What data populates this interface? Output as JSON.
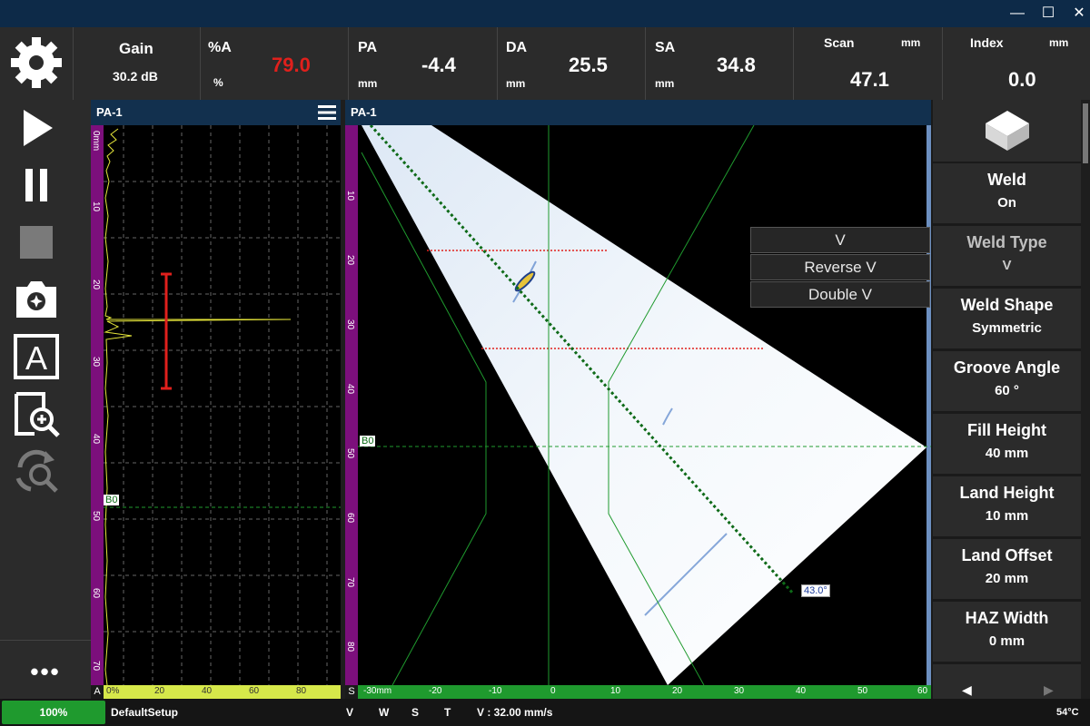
{
  "window": {
    "minimize": "—",
    "maximize": "☐",
    "close": "✕"
  },
  "sidebar": {
    "items": [
      {
        "name": "settings-gear-icon"
      },
      {
        "name": "play-icon"
      },
      {
        "name": "pause-icon"
      },
      {
        "name": "stop-icon"
      },
      {
        "name": "snapshot-icon"
      },
      {
        "name": "text-annotation-icon"
      },
      {
        "name": "zoom-icon"
      },
      {
        "name": "rotate-zoom-icon"
      }
    ],
    "more": "•••"
  },
  "readouts": {
    "gain": {
      "label": "Gain",
      "value": "30.2 dB"
    },
    "pctA": {
      "label": "%A",
      "unit": "%",
      "value": "79.0",
      "color": "#e0201c"
    },
    "pa": {
      "label": "PA",
      "unit": "mm",
      "value": "-4.4"
    },
    "da": {
      "label": "DA",
      "unit": "mm",
      "value": "25.5"
    },
    "sa": {
      "label": "SA",
      "unit": "mm",
      "value": "34.8"
    },
    "scan": {
      "label": "Scan",
      "unit": "mm",
      "value": "47.1"
    },
    "index": {
      "label": "Index",
      "unit": "mm",
      "value": "0.0"
    }
  },
  "ascan": {
    "title": "PA-1",
    "menu_icon": "hamburger-menu-icon",
    "depth_ticks": [
      "0mm",
      "10",
      "20",
      "30",
      "30",
      "40",
      "50",
      "60",
      "70"
    ],
    "amp_ticks": [
      "0%",
      "20",
      "40",
      "60",
      "80"
    ],
    "corner": "A",
    "gate_label": "B0"
  },
  "sscan": {
    "title": "PA-1",
    "depth_ticks": [
      "10",
      "20",
      "30",
      "40",
      "50",
      "60",
      "70",
      "80"
    ],
    "x_ticks": [
      "-30mm",
      "-20",
      "-10",
      "0",
      "10",
      "20",
      "30",
      "40",
      "50",
      "60"
    ],
    "corner": "S",
    "gate_label": "B0",
    "angle_label": "43.0°"
  },
  "dropdown": {
    "options": [
      "V",
      "Reverse V",
      "Double V"
    ]
  },
  "right_panel": {
    "icon": "weld-block-icon",
    "items": [
      {
        "title": "Weld",
        "value": "On"
      },
      {
        "title": "Weld Type",
        "value": "V"
      },
      {
        "title": "Weld Shape",
        "value": "Symmetric"
      },
      {
        "title": "Groove Angle",
        "value": "60 °"
      },
      {
        "title": "Fill Height",
        "value": "40 mm"
      },
      {
        "title": "Land Height",
        "value": "10 mm"
      },
      {
        "title": "Land Offset",
        "value": "20 mm"
      },
      {
        "title": "HAZ Width",
        "value": "0 mm"
      }
    ],
    "prev": "◀",
    "next": "▶"
  },
  "status": {
    "battery": "100%",
    "setup": "DefaultSetup",
    "v": "V",
    "w": "W",
    "s": "S",
    "t": "T",
    "velocity": "V : 32.00 mm/s",
    "temp": "54°C"
  },
  "colors": {
    "accent_green": "#1f9a2e",
    "title_blue": "#0d2a48",
    "gate_red": "#e0201c"
  }
}
